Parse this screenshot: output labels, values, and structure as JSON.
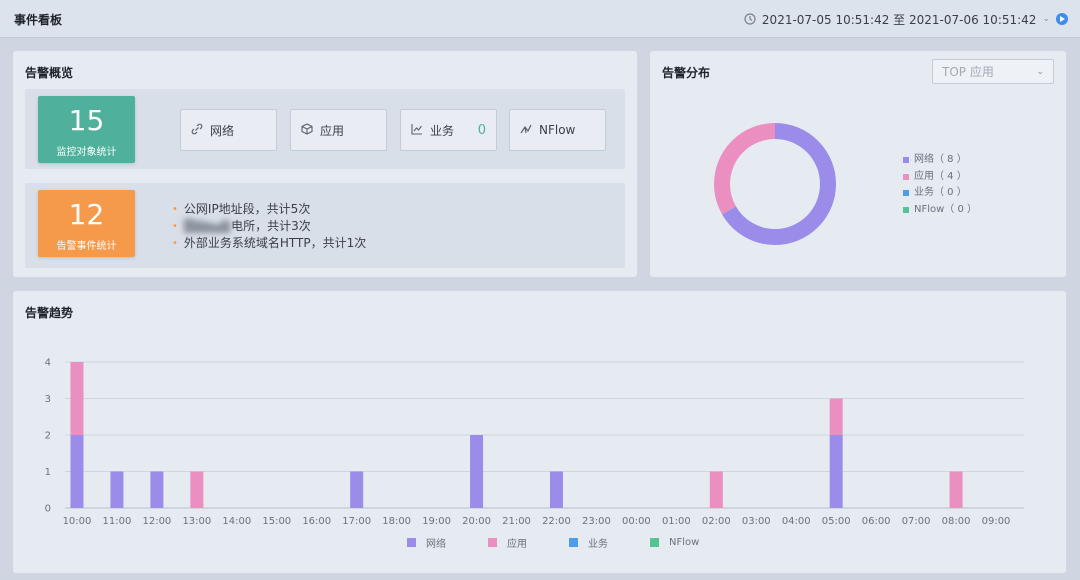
{
  "app": {
    "title": "事件看板",
    "date_range": "2021-07-05 10:51:42 至 2021-07-06 10:51:42"
  },
  "colors": {
    "network": "#9b8cea",
    "application": "#ea8fc0",
    "business": "#4f9de8",
    "nflow": "#54c495",
    "monitor_card": "#4fb09c",
    "alarm_card": "#f59a4a"
  },
  "overview": {
    "title": "告警概览",
    "monitor_count": "15",
    "monitor_label": "监控对象统计",
    "alarm_count": "12",
    "alarm_label": "告警事件统计",
    "categories": [
      {
        "label": "网络",
        "value": "",
        "icon": "link-icon"
      },
      {
        "label": "应用",
        "value": "",
        "icon": "cube-icon"
      },
      {
        "label": "业务",
        "value": "0",
        "icon": "trend-icon"
      },
      {
        "label": "NFlow",
        "value": "",
        "icon": "flow-icon"
      }
    ],
    "events": [
      {
        "prefix": "",
        "text": "公网IP地址段，共计5次"
      },
      {
        "prefix": "",
        "text": "电所，共计3次"
      },
      {
        "prefix": "",
        "text": "外部业务系统域名HTTP，共计1次"
      }
    ]
  },
  "distribution": {
    "title": "告警分布",
    "select_value": "TOP 应用",
    "legend": [
      {
        "label": "网络（ 8 ）",
        "value": 8,
        "color": "#9b8cea"
      },
      {
        "label": "应用（ 4 ）",
        "value": 4,
        "color": "#ea8fc0"
      },
      {
        "label": "业务（ 0 ）",
        "value": 0,
        "color": "#4f9de8"
      },
      {
        "label": "NFlow（ 0 ）",
        "value": 0,
        "color": "#54c495"
      }
    ]
  },
  "trend": {
    "title": "告警趋势"
  },
  "chart_data": {
    "type": "bar",
    "stacked": true,
    "categories": [
      "10:00",
      "11:00",
      "12:00",
      "13:00",
      "14:00",
      "15:00",
      "16:00",
      "17:00",
      "18:00",
      "19:00",
      "20:00",
      "21:00",
      "22:00",
      "23:00",
      "00:00",
      "01:00",
      "02:00",
      "03:00",
      "04:00",
      "05:00",
      "06:00",
      "07:00",
      "08:00",
      "09:00"
    ],
    "series": [
      {
        "name": "网络",
        "color": "#9b8cea",
        "values": [
          2,
          1,
          1,
          0,
          0,
          0,
          0,
          1,
          0,
          0,
          2,
          0,
          1,
          0,
          0,
          0,
          0,
          0,
          0,
          2,
          0,
          0,
          0,
          0
        ]
      },
      {
        "name": "应用",
        "color": "#ea8fc0",
        "values": [
          2,
          0,
          0,
          1,
          0,
          0,
          0,
          0,
          0,
          0,
          0,
          0,
          0,
          0,
          0,
          0,
          1,
          0,
          0,
          1,
          0,
          0,
          1,
          0
        ]
      },
      {
        "name": "业务",
        "color": "#4f9de8",
        "values": [
          0,
          0,
          0,
          0,
          0,
          0,
          0,
          0,
          0,
          0,
          0,
          0,
          0,
          0,
          0,
          0,
          0,
          0,
          0,
          0,
          0,
          0,
          0,
          0
        ]
      },
      {
        "name": "NFlow",
        "color": "#54c495",
        "values": [
          0,
          0,
          0,
          0,
          0,
          0,
          0,
          0,
          0,
          0,
          0,
          0,
          0,
          0,
          0,
          0,
          0,
          0,
          0,
          0,
          0,
          0,
          0,
          0
        ]
      }
    ],
    "yticks": [
      "0",
      "1",
      "2",
      "3",
      "4"
    ],
    "ylim": [
      0,
      4
    ],
    "grid": true,
    "legend": "bottom"
  }
}
